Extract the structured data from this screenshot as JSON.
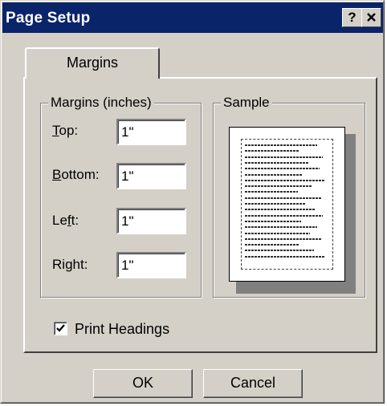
{
  "window": {
    "title": "Page Setup",
    "help_label": "?",
    "close_label": "×"
  },
  "tabs": [
    {
      "label": "Margins",
      "selected": true
    }
  ],
  "margins_group": {
    "legend": "Margins (inches)",
    "fields": {
      "top": {
        "label_pre": "",
        "label_mnemonic": "T",
        "label_post": "op:",
        "value": "1\""
      },
      "bottom": {
        "label_pre": "",
        "label_mnemonic": "B",
        "label_post": "ottom:",
        "value": "1\""
      },
      "left": {
        "label_pre": "Le",
        "label_mnemonic": "f",
        "label_post": "t:",
        "value": "1\""
      },
      "right": {
        "label_pre": "Ri",
        "label_mnemonic": "g",
        "label_post": "ht:",
        "value": "1\""
      }
    }
  },
  "sample_group": {
    "legend": "Sample"
  },
  "print_headings": {
    "label": "Print Headings",
    "checked": true
  },
  "buttons": {
    "ok": "OK",
    "cancel": "Cancel"
  },
  "colors": {
    "face": "#d4d0c8",
    "titlebar": "#0a246a"
  }
}
